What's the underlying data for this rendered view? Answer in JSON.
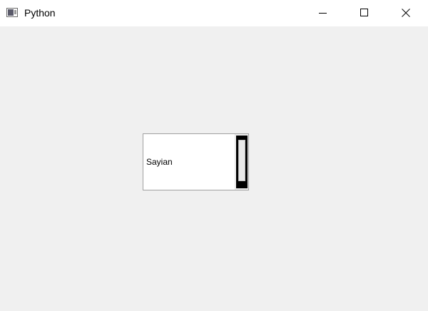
{
  "window": {
    "title": "Python",
    "icons": {
      "app": "tk-feather-window-icon",
      "minimize": "minimize-icon",
      "maximize": "maximize-icon",
      "close": "close-icon"
    }
  },
  "widget": {
    "text": "Sayian"
  },
  "colors": {
    "titlebar": "#ffffff",
    "client_background": "#f0f0f0",
    "widget_background": "#ffffff",
    "scrollbar": "#000000"
  }
}
